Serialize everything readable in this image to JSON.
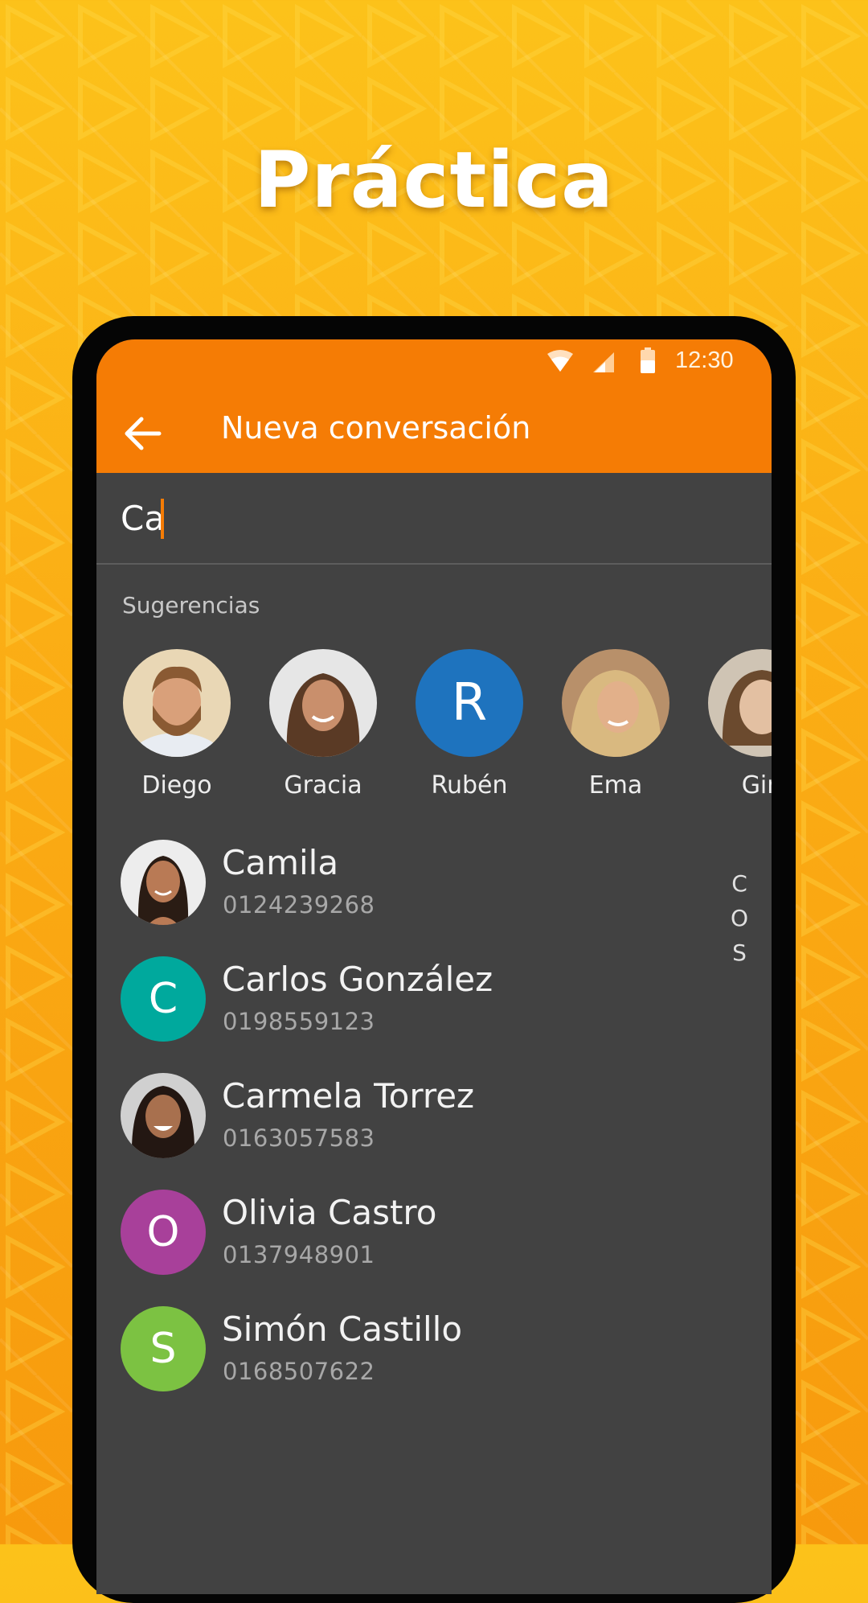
{
  "headline": "Práctica",
  "colors": {
    "accent": "#f57c05",
    "background": "#fbae15",
    "screen": "#424242",
    "ruben": "#1e73be",
    "carlos": "#00a99d",
    "olivia": "#a8409a",
    "simon": "#7cc242"
  },
  "status_bar": {
    "time": "12:30",
    "icons": [
      "wifi-icon",
      "signal-icon",
      "battery-icon"
    ]
  },
  "app_bar": {
    "back_icon": "arrow-left-icon",
    "title": "Nueva conversación"
  },
  "search": {
    "value": "Ca"
  },
  "suggestions": {
    "label": "Sugerencias",
    "items": [
      {
        "name": "Diego",
        "avatar": "photo"
      },
      {
        "name": "Gracia",
        "avatar": "photo"
      },
      {
        "name": "Rubén",
        "avatar": "letter",
        "initial": "R"
      },
      {
        "name": "Ema",
        "avatar": "photo"
      },
      {
        "name": "Gin",
        "avatar": "photo"
      }
    ]
  },
  "contacts": [
    {
      "name": "Camila",
      "phone": "0124239268",
      "avatar": "photo"
    },
    {
      "name": "Carlos González",
      "phone": "0198559123",
      "avatar": "letter",
      "initial": "C"
    },
    {
      "name": "Carmela Torrez",
      "phone": "0163057583",
      "avatar": "photo"
    },
    {
      "name": "Olivia Castro",
      "phone": "0137948901",
      "avatar": "letter",
      "initial": "O"
    },
    {
      "name": "Simón Castillo",
      "phone": "0168507622",
      "avatar": "letter",
      "initial": "S"
    }
  ],
  "index_letters": [
    "C",
    "O",
    "S"
  ]
}
